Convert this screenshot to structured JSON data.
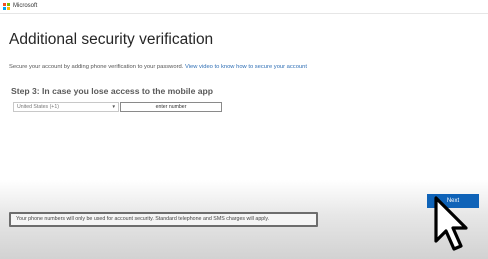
{
  "header": {
    "brand": "Microsoft",
    "logo_colors": [
      "#f25022",
      "#7fba00",
      "#00a4ef",
      "#ffb900"
    ]
  },
  "page": {
    "title": "Additional security verification",
    "intro_text": "Secure your account by adding phone verification to your password.",
    "intro_link": "View video to know how to secure your account",
    "step_title": "Step 3: In case you lose access to the mobile app"
  },
  "form": {
    "country_value": "United States (+1)",
    "country_chevron": "▼",
    "phone_placeholder": "enter number"
  },
  "notice": {
    "text": "Your phone numbers will only be used for account security. Standard telephone and SMS charges will apply."
  },
  "actions": {
    "next_label": "Next",
    "accent_color": "#0f63b8"
  },
  "cursor": {
    "icon": "mouse-pointer-icon"
  }
}
